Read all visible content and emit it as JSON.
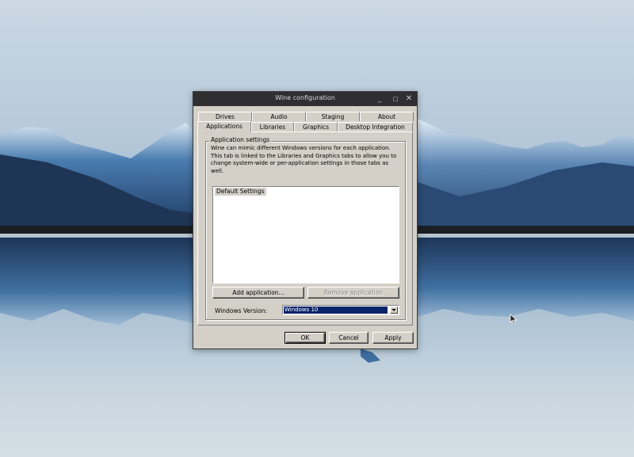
{
  "window": {
    "title": "Wine configuration",
    "controls": {
      "minimize": "_",
      "maximize": "□",
      "close": "✕"
    }
  },
  "tabs": {
    "row_back": [
      "Drives",
      "Audio",
      "Staging",
      "About"
    ],
    "row_front": [
      "Applications",
      "Libraries",
      "Graphics",
      "Desktop Integration"
    ],
    "active": "Applications"
  },
  "applications": {
    "group_title": "Application settings",
    "description": "Wine can mimic different Windows versions for each application. This tab is linked to the Libraries and Graphics tabs to allow you to change system-wide or per-application settings in those tabs as well.",
    "list_items": [
      "Default Settings"
    ],
    "add_button": "Add application...",
    "remove_button": "Remove application",
    "version_label": "Windows Version:",
    "version_value": "Windows 10"
  },
  "footer": {
    "ok": "OK",
    "cancel": "Cancel",
    "apply": "Apply"
  },
  "colors": {
    "dialog_bg": "#d4d0c8",
    "titlebar_bg": "#2f2f31",
    "selection": "#0a246a"
  }
}
